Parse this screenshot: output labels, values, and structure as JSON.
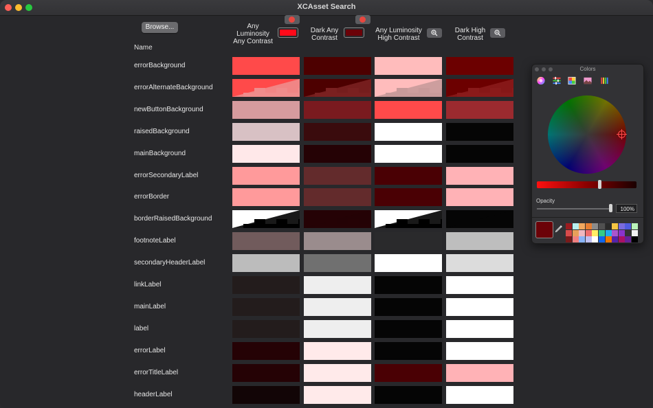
{
  "window": {
    "title": "XCAsset Search"
  },
  "toolbar": {
    "browse_label": "Browse..."
  },
  "table": {
    "name_header": "Name",
    "columns": [
      {
        "title_lines": [
          "Any",
          "Luminosity",
          "Any Contrast"
        ],
        "swatch_color": "#ff0a1a",
        "control": "clear"
      },
      {
        "title_lines": [
          "Dark Any",
          "Contrast"
        ],
        "swatch_color": "#6b0208",
        "control": "clear"
      },
      {
        "title_lines": [
          "Any Luminosity",
          "High Contrast"
        ],
        "control": "zoom"
      },
      {
        "title_lines": [
          "Dark High",
          "Contrast"
        ],
        "control": "zoom"
      }
    ],
    "rows": [
      {
        "name": "errorBackground",
        "colors": [
          "#ff4a4a",
          "#4d0000",
          "#ffbcbc",
          "#6c0000"
        ]
      },
      {
        "name": "errorAlternateBackground",
        "pattern": true,
        "colors": [
          "#ff4a4a",
          "#4d0000",
          "#ffbcbc",
          "#6c0000"
        ],
        "alt": [
          "#f08c8c",
          "#7a2020",
          "#c89a9a",
          "#8a1a1a"
        ]
      },
      {
        "name": "newButtonBackground",
        "colors": [
          "#d69b9e",
          "#7a1a1f",
          "#ff4a4a",
          "#9b2a2f"
        ]
      },
      {
        "name": "raisedBackground",
        "colors": [
          "#d8c1c4",
          "#3a0b0d",
          "#ffffff",
          "#050505"
        ]
      },
      {
        "name": "mainBackground",
        "colors": [
          "#ffe8e9",
          "#250205",
          "#ffffff",
          "#050505"
        ]
      },
      {
        "name": "errorSecondaryLabel",
        "colors": [
          "#ff9a9b",
          "#632b2c",
          "#4a0004",
          "#ffb2b6"
        ]
      },
      {
        "name": "errorBorder",
        "colors": [
          "#ff9a9b",
          "#632b2c",
          "#4a0004",
          "#ffb2b6"
        ]
      },
      {
        "name": "borderRaisedBackground",
        "pattern": true,
        "colors": [
          "#ffffff",
          "#250205",
          "#ffffff",
          "#050505"
        ],
        "alt": [
          "#000000",
          "#250205",
          "#000000",
          "#050505"
        ]
      },
      {
        "name": "footnoteLabel",
        "colors": [
          "#715b5c",
          "#9a8c8d",
          "#2a2a2c",
          "#bebebe"
        ]
      },
      {
        "name": "secondaryHeaderLabel",
        "colors": [
          "#bcbcbc",
          "#707070",
          "#ffffff",
          "#dcdcdc"
        ]
      },
      {
        "name": "linkLabel",
        "colors": [
          "#231c1c",
          "#eeeeee",
          "#050505",
          "#ffffff"
        ]
      },
      {
        "name": "mainLabel",
        "colors": [
          "#231c1c",
          "#eeeeee",
          "#050505",
          "#ffffff"
        ]
      },
      {
        "name": "label",
        "colors": [
          "#231c1c",
          "#eeeeee",
          "#050505",
          "#ffffff"
        ]
      },
      {
        "name": "errorLabel",
        "colors": [
          "#250205",
          "#ffeaea",
          "#050505",
          "#ffffff"
        ]
      },
      {
        "name": "errorTitleLabel",
        "colors": [
          "#250205",
          "#ffeaea",
          "#4a0004",
          "#ffb2b6"
        ]
      },
      {
        "name": "headerLabel",
        "colors": [
          "#120506",
          "#ffeaea",
          "#050505",
          "#ffffff"
        ]
      }
    ]
  },
  "colors_panel": {
    "title": "Colors",
    "tabs": [
      "color-wheel-icon",
      "sliders-icon",
      "color-palettes-icon",
      "image-palettes-icon",
      "pencils-icon"
    ],
    "opacity_label": "Opacity",
    "opacity_value": "100%",
    "opacity": 1.0,
    "current_color": "#6b0208",
    "palette": [
      "#9b1c20",
      "#b8f0f0",
      "#f2a85e",
      "#e77e31",
      "#8b8b8b",
      "#505050",
      "#2a2a2a",
      "#f5c542",
      "#7a6bde",
      "#4f5be0",
      "#b9f3b9",
      "#d84b4b",
      "#e8a05a",
      "#f0b8c0",
      "#f06d6d",
      "#ffee66",
      "#33cc88",
      "#22aaee",
      "#aa55cc",
      "#8a33cc",
      "#333333",
      "#f2f2f2",
      "#7a1a1a",
      "#f08080",
      "#8ab4f8",
      "#c0c0f0",
      "#ffffff",
      "#1166ee",
      "#ee7700",
      "#5522aa",
      "#aa1166",
      "#662299",
      "#000000"
    ]
  }
}
